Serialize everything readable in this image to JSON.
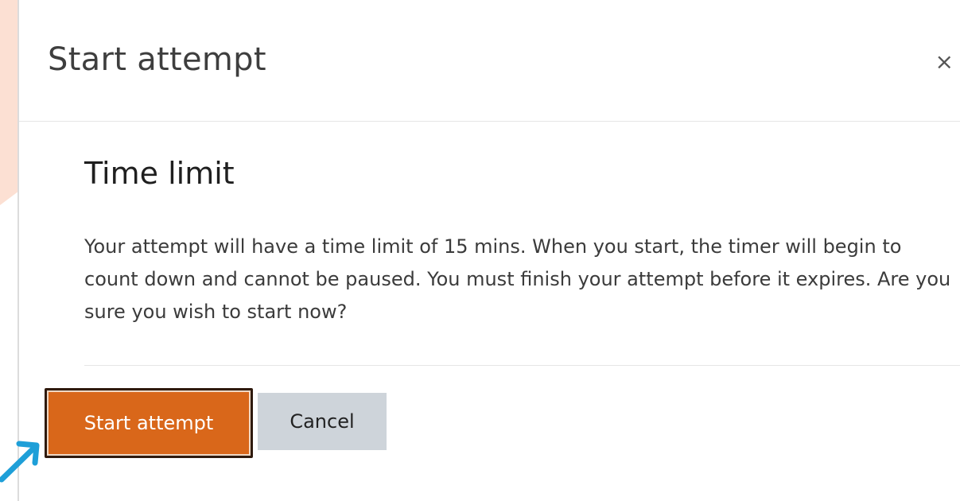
{
  "modal": {
    "title": "Start attempt",
    "close_symbol": "×",
    "close_icon": "close-icon",
    "section_heading": "Time limit",
    "message": "Your attempt will have a time limit of 15 mins. When you start, the timer will begin to count down and cannot be paused. You must finish your attempt before it expires. Are you sure you wish to start now?",
    "primary_button": "Start attempt",
    "secondary_button": "Cancel"
  },
  "colors": {
    "primary": "#d9671a",
    "secondary_bg": "#ced4da",
    "accent_bg": "#fce0d3",
    "arrow": "#1e9fd8"
  },
  "annotation": {
    "arrow_icon": "arrow-pointer-icon"
  }
}
